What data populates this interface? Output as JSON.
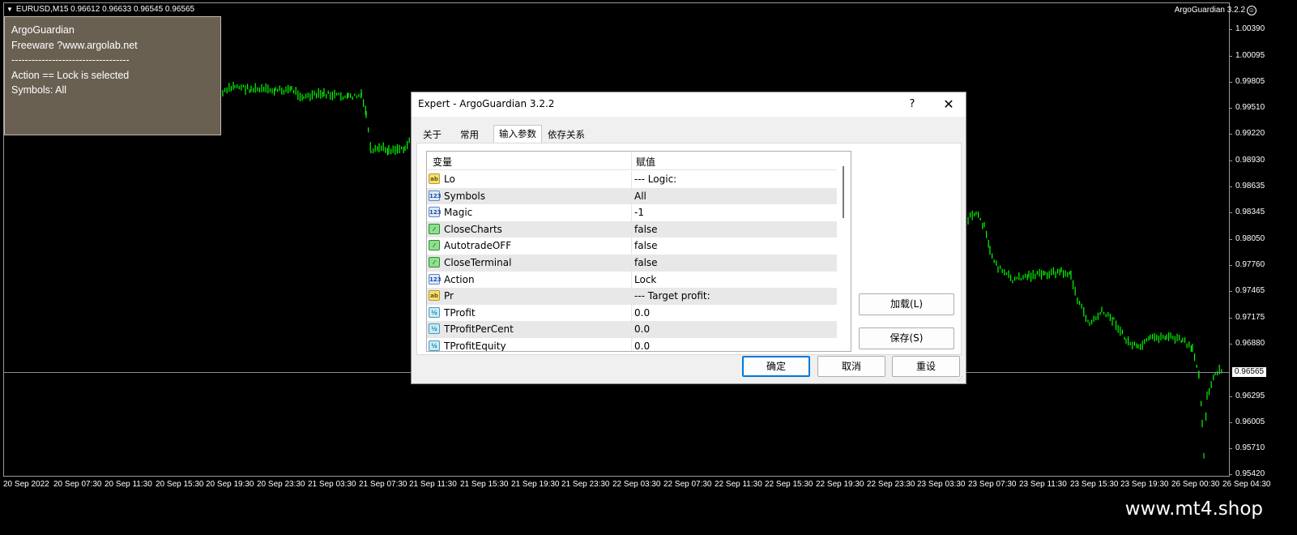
{
  "chart": {
    "symbol_line": "EURUSD,M15  0.96612 0.96633 0.96545 0.96565",
    "ea_label": "ArgoGuardian 3.2.2",
    "current_price": "0.96565",
    "price_axis": [
      "1.00390",
      "1.00095",
      "0.99805",
      "0.99510",
      "0.99220",
      "0.98930",
      "0.98635",
      "0.98345",
      "0.98050",
      "0.97760",
      "0.97465",
      "0.97175",
      "0.96880",
      "0.96295",
      "0.96005",
      "0.95710",
      "0.95420"
    ],
    "time_axis": [
      "20 Sep 2022",
      "20 Sep 07:30",
      "20 Sep 11:30",
      "20 Sep 15:30",
      "20 Sep 19:30",
      "20 Sep 23:30",
      "21 Sep 03:30",
      "21 Sep 07:30",
      "21 Sep 11:30",
      "21 Sep 15:30",
      "21 Sep 19:30",
      "21 Sep 23:30",
      "22 Sep 03:30",
      "22 Sep 07:30",
      "22 Sep 11:30",
      "22 Sep 15:30",
      "22 Sep 19:30",
      "22 Sep 23:30",
      "23 Sep 03:30",
      "23 Sep 07:30",
      "23 Sep 11:30",
      "23 Sep 15:30",
      "23 Sep 19:30",
      "26 Sep 00:30",
      "26 Sep 04:30"
    ],
    "candle_color": "#00ff00"
  },
  "info_panel": {
    "lines": [
      "ArgoGuardian",
      "Freeware ?www.argolab.net",
      "-----------------------------------",
      "Action == Lock is selected",
      "Symbols: All"
    ]
  },
  "dialog": {
    "title": "Expert - ArgoGuardian 3.2.2",
    "help": "?",
    "close": "✕",
    "tabs": [
      "关于",
      "常用",
      "输入参数",
      "依存关系"
    ],
    "grid_headers": {
      "variable": "变量",
      "value": "赋值"
    },
    "rows": [
      {
        "icon": "ab",
        "name": "Lo",
        "value": "--- Logic:"
      },
      {
        "icon": "123",
        "name": "Symbols",
        "value": "All"
      },
      {
        "icon": "123",
        "name": "Magic",
        "value": "-1"
      },
      {
        "icon": "bool",
        "name": "CloseCharts",
        "value": "false"
      },
      {
        "icon": "bool",
        "name": "AutotradeOFF",
        "value": "false"
      },
      {
        "icon": "bool",
        "name": "CloseTerminal",
        "value": "false"
      },
      {
        "icon": "123",
        "name": "Action",
        "value": "Lock"
      },
      {
        "icon": "ab",
        "name": "Pr",
        "value": "--- Target profit:"
      },
      {
        "icon": "half",
        "name": "TProfit",
        "value": "0.0"
      },
      {
        "icon": "half",
        "name": "TProfitPerCent",
        "value": "0.0"
      },
      {
        "icon": "half",
        "name": "TProfitEquity",
        "value": "0.0"
      }
    ],
    "buttons": {
      "load": "加载(L)",
      "save": "保存(S)",
      "ok": "确定",
      "cancel": "取消",
      "reset": "重设"
    }
  },
  "footer": {
    "watermark": "www.mt4.shop"
  }
}
